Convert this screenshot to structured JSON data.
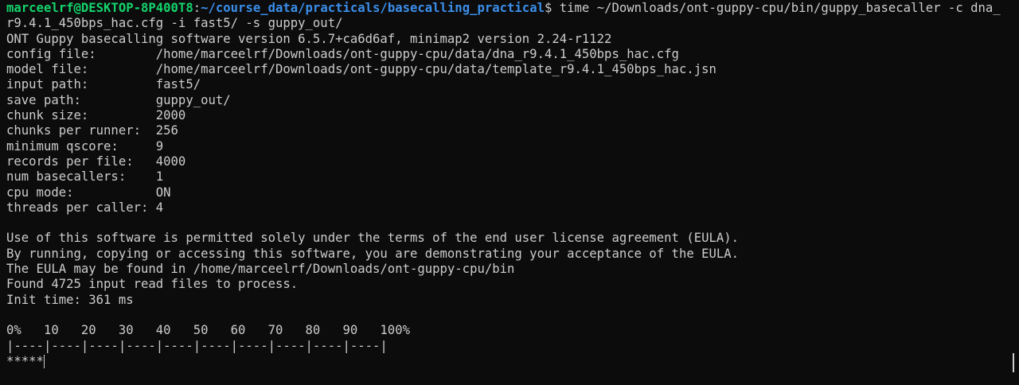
{
  "prompt": {
    "user_host": "marceelrf@DESKTOP-8P400T8",
    "separator": ":",
    "cwd": "~/course_data/practicals/basecalling_practical",
    "symbol": "$",
    "command_part1": " time ~/Downloads/ont-guppy-cpu/bin/guppy_basecaller -c dna_",
    "command_part2": "r9.4.1_450bps_hac.cfg -i fast5/ -s guppy_out/"
  },
  "output": {
    "version_line": "ONT Guppy basecalling software version 6.5.7+ca6d6af, minimap2 version 2.24-r1122",
    "config": [
      "config file:        /home/marceelrf/Downloads/ont-guppy-cpu/data/dna_r9.4.1_450bps_hac.cfg",
      "model file:         /home/marceelrf/Downloads/ont-guppy-cpu/data/template_r9.4.1_450bps_hac.jsn",
      "input path:         fast5/",
      "save path:          guppy_out/",
      "chunk size:         2000",
      "chunks per runner:  256",
      "minimum qscore:     9",
      "records per file:   4000",
      "num basecallers:    1",
      "cpu mode:           ON",
      "threads per caller: 4"
    ],
    "eula": [
      "Use of this software is permitted solely under the terms of the end user license agreement (EULA).",
      "By running, copying or accessing this software, you are demonstrating your acceptance of the EULA.",
      "The EULA may be found in /home/marceelrf/Downloads/ont-guppy-cpu/bin"
    ],
    "found_line": "Found 4725 input read files to process.",
    "init_line": "Init time: 361 ms",
    "progress_scale": "0%   10   20   30   40   50   60   70   80   90   100%",
    "progress_ruler": "|----|----|----|----|----|----|----|----|----|----|",
    "progress_stars": "*****",
    "progress_fraction": 0.1
  },
  "colors": {
    "background": "#0c0c0c",
    "text": "#cccccc",
    "user_host": "#13d36b",
    "path": "#3b8eea"
  }
}
